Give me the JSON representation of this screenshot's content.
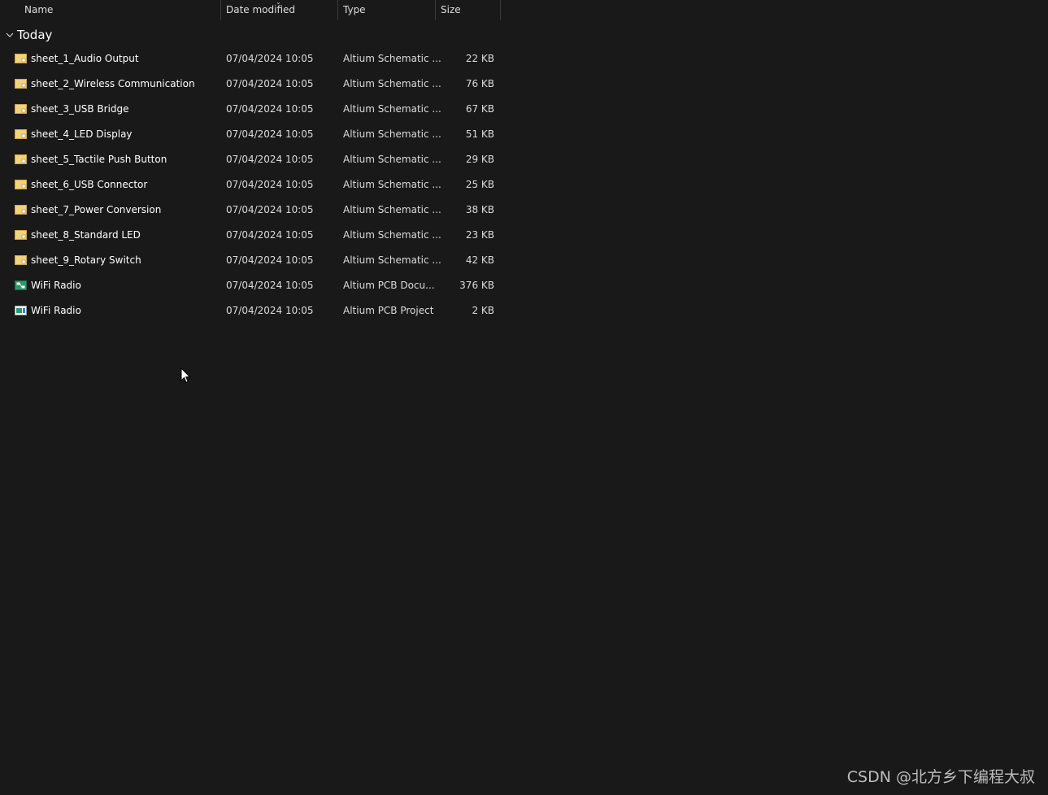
{
  "columns": {
    "name": "Name",
    "date": "Date modified",
    "type": "Type",
    "size": "Size"
  },
  "group": {
    "title": "Today"
  },
  "files": [
    {
      "name": "sheet_1_Audio Output",
      "date": "07/04/2024 10:05",
      "type": "Altium Schematic ...",
      "size": "22 KB",
      "icon": "schematic-file-icon"
    },
    {
      "name": "sheet_2_Wireless Communication",
      "date": "07/04/2024 10:05",
      "type": "Altium Schematic ...",
      "size": "76 KB",
      "icon": "schematic-file-icon"
    },
    {
      "name": "sheet_3_USB Bridge",
      "date": "07/04/2024 10:05",
      "type": "Altium Schematic ...",
      "size": "67 KB",
      "icon": "schematic-file-icon"
    },
    {
      "name": "sheet_4_LED Display",
      "date": "07/04/2024 10:05",
      "type": "Altium Schematic ...",
      "size": "51 KB",
      "icon": "schematic-file-icon"
    },
    {
      "name": "sheet_5_Tactile Push Button",
      "date": "07/04/2024 10:05",
      "type": "Altium Schematic ...",
      "size": "29 KB",
      "icon": "schematic-file-icon"
    },
    {
      "name": "sheet_6_USB Connector",
      "date": "07/04/2024 10:05",
      "type": "Altium Schematic ...",
      "size": "25 KB",
      "icon": "schematic-file-icon"
    },
    {
      "name": "sheet_7_Power Conversion",
      "date": "07/04/2024 10:05",
      "type": "Altium Schematic ...",
      "size": "38 KB",
      "icon": "schematic-file-icon"
    },
    {
      "name": "sheet_8_Standard LED",
      "date": "07/04/2024 10:05",
      "type": "Altium Schematic ...",
      "size": "23 KB",
      "icon": "schematic-file-icon"
    },
    {
      "name": "sheet_9_Rotary Switch",
      "date": "07/04/2024 10:05",
      "type": "Altium Schematic ...",
      "size": "42 KB",
      "icon": "schematic-file-icon"
    },
    {
      "name": "WiFi Radio",
      "date": "07/04/2024 10:05",
      "type": "Altium PCB Docu...",
      "size": "376 KB",
      "icon": "pcb-document-icon"
    },
    {
      "name": "WiFi Radio",
      "date": "07/04/2024 10:05",
      "type": "Altium PCB Project",
      "size": "2 KB",
      "icon": "pcb-project-icon"
    }
  ],
  "watermark": "CSDN @北方乡下编程大叔",
  "colors": {
    "background": "#191919",
    "schematic_icon": "#f2d27a",
    "pcb_icon": "#2e9a6c"
  }
}
